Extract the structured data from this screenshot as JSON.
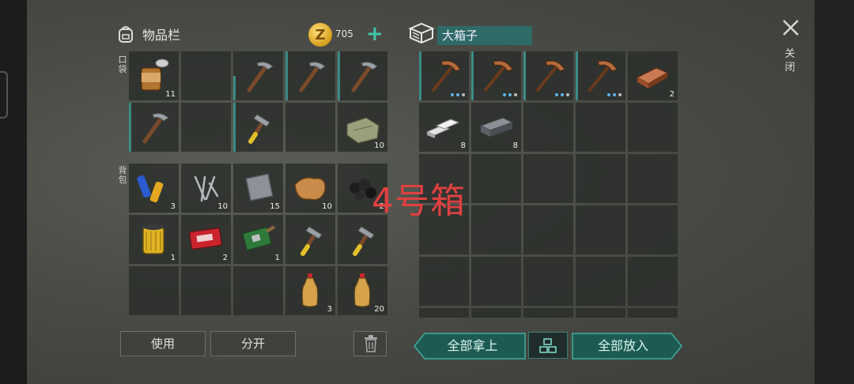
{
  "inventory": {
    "title": "物品栏",
    "coins": "705",
    "add_coin": "+",
    "pocket_label": "口袋",
    "backpack_label": "背包",
    "pocket_slots": [
      {
        "item": "canned-food-icon",
        "qty": "11"
      },
      {
        "item": "",
        "qty": ""
      },
      {
        "item": "pickaxe-icon",
        "qty": "",
        "bar": "half"
      },
      {
        "item": "pickaxe-icon",
        "qty": "",
        "bar": "full"
      },
      {
        "item": "pickaxe-icon",
        "qty": "",
        "bar": "full"
      },
      {
        "item": "pickaxe-icon",
        "qty": "",
        "bar": "full"
      },
      {
        "item": "",
        "qty": ""
      },
      {
        "item": "hammer-icon",
        "qty": "",
        "bar": "full"
      },
      {
        "item": "",
        "qty": ""
      },
      {
        "item": "cloth-icon",
        "qty": "10"
      }
    ],
    "backpack_slots": [
      {
        "item": "battery-icon",
        "qty": "3"
      },
      {
        "item": "nails-icon",
        "qty": "10"
      },
      {
        "item": "metal-plate-icon",
        "qty": "15"
      },
      {
        "item": "leather-icon",
        "qty": "10"
      },
      {
        "item": "coal-icon",
        "qty": "2"
      },
      {
        "item": "oil-filter-icon",
        "qty": "1"
      },
      {
        "item": "coupon-icon",
        "qty": "2"
      },
      {
        "item": "circuit-board-icon",
        "qty": "1"
      },
      {
        "item": "hammer-icon",
        "qty": ""
      },
      {
        "item": "hammer-icon",
        "qty": ""
      },
      {
        "item": "",
        "qty": ""
      },
      {
        "item": "",
        "qty": ""
      },
      {
        "item": "",
        "qty": ""
      },
      {
        "item": "bottle-icon",
        "qty": "3"
      },
      {
        "item": "bottle-icon",
        "qty": "20"
      }
    ],
    "use_button": "使用",
    "split_button": "分开"
  },
  "box": {
    "title": "大箱子",
    "slots": [
      {
        "item": "copper-pickaxe-icon",
        "qty": "",
        "dots": true,
        "bar": "full"
      },
      {
        "item": "copper-pickaxe-icon",
        "qty": "",
        "dots": true,
        "bar": "full"
      },
      {
        "item": "copper-pickaxe-icon",
        "qty": "",
        "dots": true,
        "bar": "full"
      },
      {
        "item": "copper-pickaxe-icon",
        "qty": "",
        "dots": true,
        "bar": "full"
      },
      {
        "item": "copper-ingot-icon",
        "qty": "2"
      },
      {
        "item": "silver-ingots-icon",
        "qty": "8"
      },
      {
        "item": "iron-ingot-icon",
        "qty": "8"
      }
    ],
    "take_all_button": "全部拿上",
    "put_all_button": "全部放入"
  },
  "close_label": "关闭",
  "overlay_label": "4号箱",
  "colors": {
    "accent": "#3b8b84",
    "overlay": "#e04040"
  }
}
